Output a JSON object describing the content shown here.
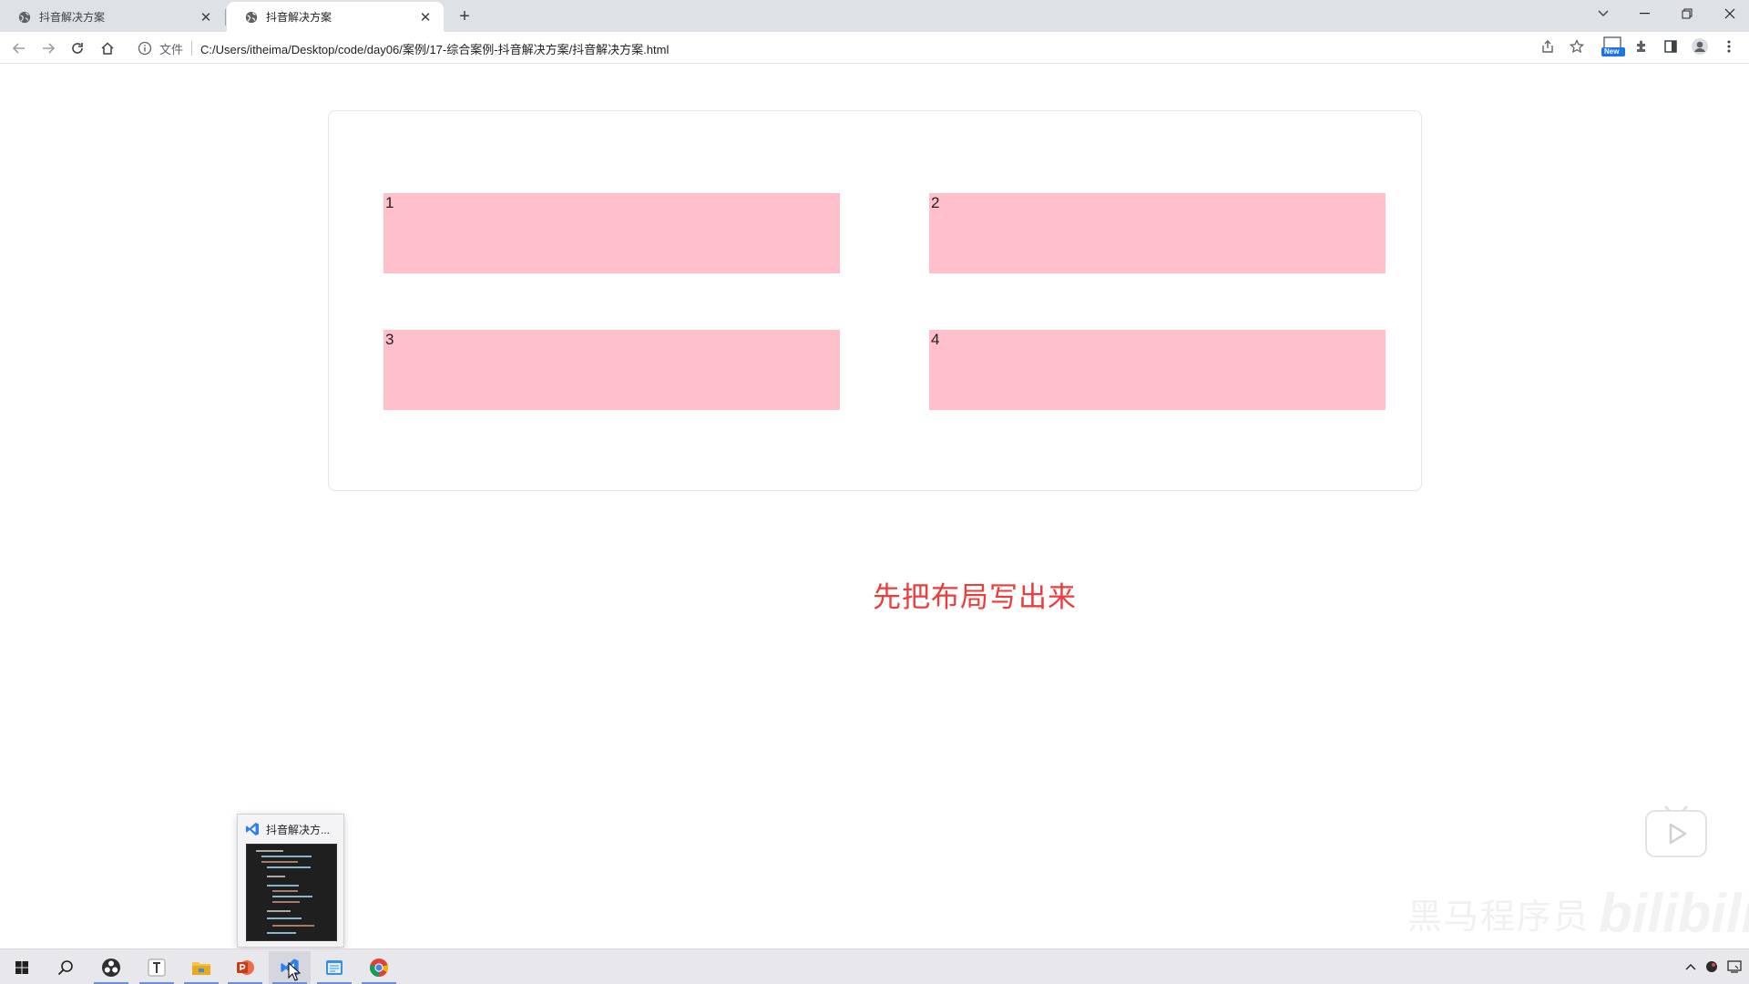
{
  "browser": {
    "tabs": [
      {
        "title": "抖音解决方案",
        "active": false
      },
      {
        "title": "抖音解决方案",
        "active": true
      }
    ],
    "address": {
      "label": "文件",
      "url": "C:/Users/itheima/Desktop/code/day06/案例/17-综合案例-抖音解决方案/抖音解决方案.html"
    },
    "extension_badge": "New"
  },
  "page": {
    "cells": [
      "1",
      "2",
      "3",
      "4"
    ],
    "hint": "先把布局写出来",
    "cell_color": "#ffc0cb",
    "hint_color": "#ee3b3b"
  },
  "taskbar": {
    "preview_title": "抖音解决方...",
    "apps": [
      "start",
      "search",
      "obs",
      "typora",
      "file-explorer",
      "powerpoint",
      "vscode",
      "notepad",
      "chrome"
    ]
  },
  "watermark": {
    "text": "黑马程序员",
    "brand": "bilibili"
  }
}
